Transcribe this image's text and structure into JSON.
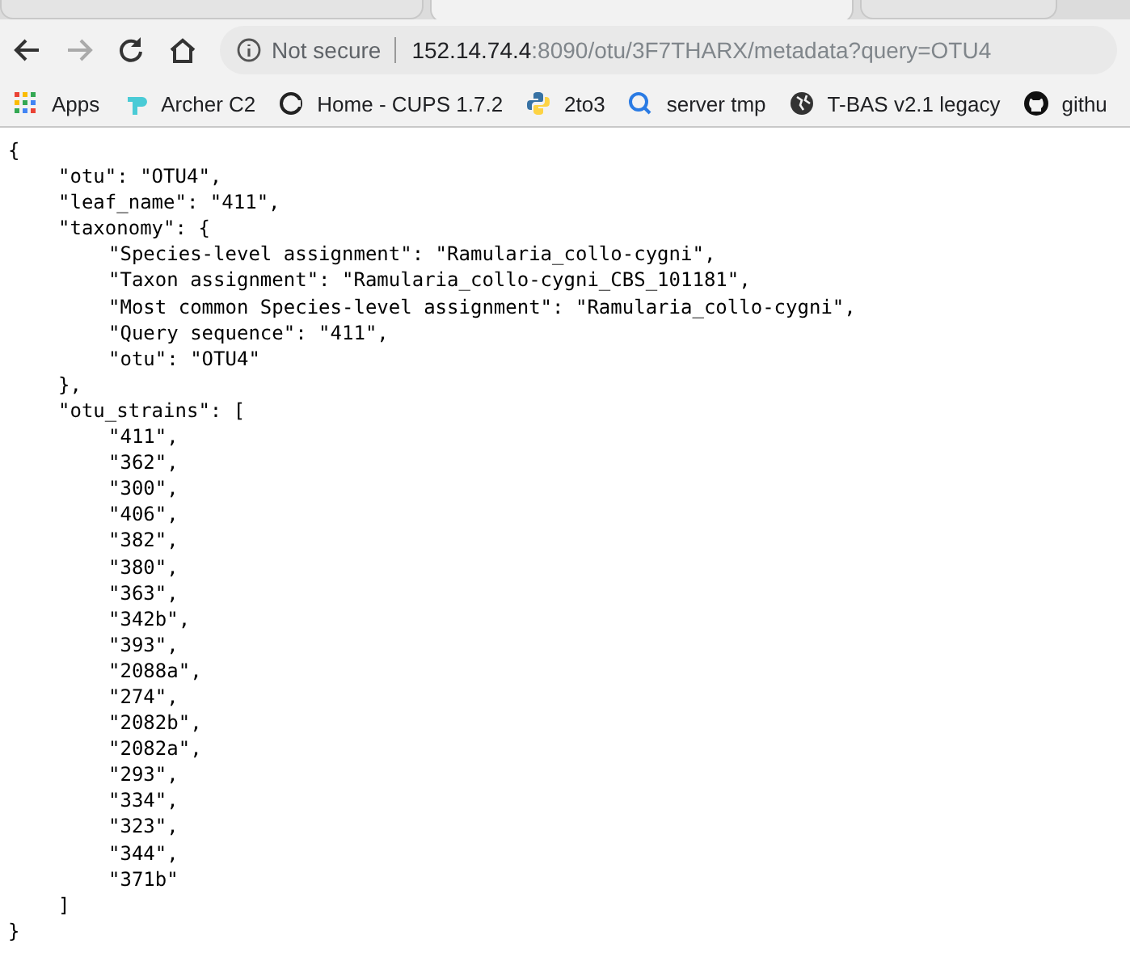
{
  "tabs": [
    {
      "selected": false
    },
    {
      "selected": true
    },
    {
      "selected": false
    }
  ],
  "address": {
    "security": "Not secure",
    "host": "152.14.74.4",
    "rest": ":8090/otu/3F7THARX/metadata?query=OTU4"
  },
  "bookmarks": [
    {
      "label": "Apps"
    },
    {
      "label": "Archer C2"
    },
    {
      "label": "Home - CUPS 1.7.2"
    },
    {
      "label": "2to3"
    },
    {
      "label": "server tmp"
    },
    {
      "label": "T-BAS v2.1 legacy"
    },
    {
      "label": "githu"
    }
  ],
  "lines": [
    {
      "text": "{",
      "children": [
        {
          "text": "\"otu\": \"OTU4\","
        },
        {
          "text": "\"leaf_name\": \"411\","
        },
        {
          "text": "\"taxonomy\": {",
          "children": [
            {
              "text": "\"Species-level assignment\": \"Ramularia_collo-cygni\","
            },
            {
              "text": "\"Taxon assignment\": \"Ramularia_collo-cygni_CBS_101181\","
            },
            {
              "text": "\"Most common Species-level assignment\": \"Ramularia_collo-cygni\","
            },
            {
              "text": "\"Query sequence\": \"411\","
            },
            {
              "text": "\"otu\": \"OTU4\""
            }
          ]
        },
        {
          "text": "},"
        },
        {
          "text": "\"otu_strains\": [",
          "children": [
            {
              "text": "\"411\","
            },
            {
              "text": "\"362\","
            },
            {
              "text": "\"300\","
            },
            {
              "text": "\"406\","
            },
            {
              "text": "\"382\","
            },
            {
              "text": "\"380\","
            },
            {
              "text": "\"363\","
            },
            {
              "text": "\"342b\","
            },
            {
              "text": "\"393\","
            },
            {
              "text": "\"2088a\","
            },
            {
              "text": "\"274\","
            },
            {
              "text": "\"2082b\","
            },
            {
              "text": "\"2082a\","
            },
            {
              "text": "\"293\","
            },
            {
              "text": "\"334\","
            },
            {
              "text": "\"323\","
            },
            {
              "text": "\"344\","
            },
            {
              "text": "\"371b\""
            }
          ]
        },
        {
          "text": "]"
        }
      ]
    },
    {
      "text": "}"
    }
  ]
}
